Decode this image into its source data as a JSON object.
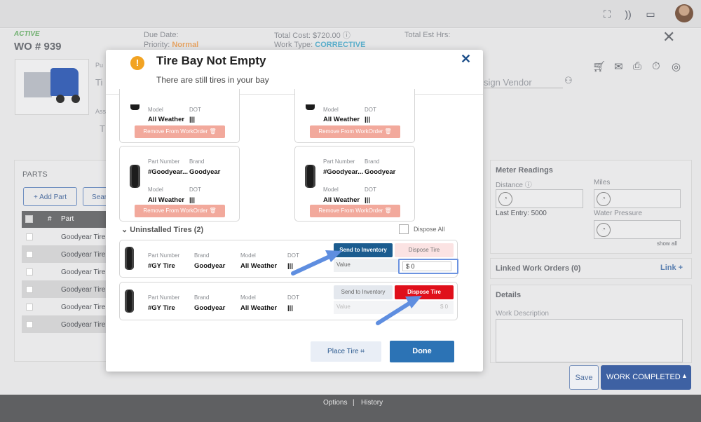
{
  "background": {
    "status": "ACTIVE",
    "wo_number": "WO # 939",
    "due_date_label": "Due Date:",
    "priority_label": "Priority:",
    "priority_value": "Normal",
    "total_cost_label": "Total Cost:",
    "total_cost_value": "$720.00",
    "work_type_label": "Work Type:",
    "work_type_value": "CORRECTIVE",
    "total_est_hrs_label": "Total Est Hrs:",
    "assign_vendor": "sign Vendor",
    "parts_title": "PARTS",
    "add_part": "+ Add Part",
    "search_partial": "Sear",
    "table_headers": [
      "#",
      "Part"
    ],
    "part_rows": [
      "Goodyear Tire",
      "Goodyear Tire",
      "Goodyear Tire",
      "Goodyear Tire",
      "Goodyear Tire",
      "Goodyear Tire"
    ],
    "meter_readings_title": "Meter Readings",
    "distance_label": "Distance",
    "miles_label": "Miles",
    "last_entry": "Last Entry: 5000",
    "water_pressure_label": "Water Pressure",
    "show_all": "show all",
    "linked_work_orders": "Linked Work Orders",
    "linked_count": "(0)",
    "link_plus": "Link +",
    "details_title": "Details",
    "work_description_label": "Work Description",
    "save_label": "Save",
    "work_completed_label": "WORK COMPLETED",
    "footer_options": "Options",
    "footer_history": "History",
    "partial_labels": {
      "pu": "Pu",
      "ti": "Ti",
      "ass": "Ass",
      "t2": "T"
    }
  },
  "modal": {
    "title": "Tire Bay Not Empty",
    "subtitle": "There are still tires in your bay",
    "top_cards": [
      {
        "model_label": "Model",
        "dot_label": "DOT",
        "model": "All Weather",
        "dot": "|||",
        "remove": "Remove From WorkOrder"
      },
      {
        "model_label": "Model",
        "dot_label": "DOT",
        "model": "All Weather",
        "dot": "|||",
        "remove": "Remove From WorkOrder"
      }
    ],
    "bay_cards": [
      {
        "part_label": "Part Number",
        "brand_label": "Brand",
        "part": "#Goodyear...",
        "brand": "Goodyear",
        "model_label": "Model",
        "dot_label": "DOT",
        "model": "All Weather",
        "dot": "|||",
        "remove": "Remove From WorkOrder"
      },
      {
        "part_label": "Part Number",
        "brand_label": "Brand",
        "part": "#Goodyear...",
        "brand": "Goodyear",
        "model_label": "Model",
        "dot_label": "DOT",
        "model": "All Weather",
        "dot": "|||",
        "remove": "Remove From WorkOrder"
      }
    ],
    "uninstalled_title": "Uninstalled Tires (2)",
    "dispose_all": "Dispose All",
    "uninstalled": [
      {
        "part_label": "Part Number",
        "brand_label": "Brand",
        "model_label": "Model",
        "dot_label": "DOT",
        "part": "#GY Tire",
        "brand": "Goodyear",
        "model": "All Weather",
        "dot": "|||",
        "send": "Send to Inventory",
        "dispose": "Dispose Tire",
        "value_label": "Value",
        "value": "$ 0"
      },
      {
        "part_label": "Part Number",
        "brand_label": "Brand",
        "model_label": "Model",
        "dot_label": "DOT",
        "part": "#GY Tire",
        "brand": "Goodyear",
        "model": "All Weather",
        "dot": "|||",
        "send": "Send to Inventory",
        "dispose": "Dispose Tire",
        "value_label": "Value",
        "value": "$ 0"
      }
    ],
    "place_tire": "Place Tire",
    "done": "Done"
  },
  "colors": {
    "accent": "#2c73b5",
    "send_active": "#1b5c8f",
    "dispose_active": "#e0101b",
    "warning": "#f2a322",
    "status_green": "#4caf50",
    "priority_orange": "#e98a2b",
    "work_type_teal": "#3a9ec2"
  },
  "icons": [
    "scan-icon",
    "rss-icon",
    "chat-icon",
    "cart-icon",
    "mail-icon",
    "print-icon",
    "timer-icon",
    "target-icon",
    "person-icon",
    "info-icon",
    "gauge-icon",
    "trash-icon",
    "grid-icon",
    "warning-icon",
    "close-icon",
    "chevron-down-icon",
    "caret-up-icon"
  ]
}
